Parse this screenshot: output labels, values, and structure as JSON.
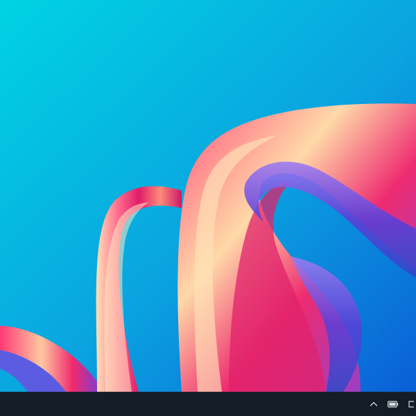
{
  "colors": {
    "wallpaper_top": "#00d0e2",
    "wallpaper_bottom": "#0a63d6",
    "ribbon_pink": "#f0246e",
    "ribbon_cream": "#ffe9c2",
    "ribbon_violet": "#6a3fe0",
    "taskbar_bg": "#141c26",
    "tray_icon": "#d8dde3"
  },
  "taskbar": {
    "tray_icons": [
      "chevron-up-icon",
      "battery-icon",
      "notification-icon"
    ]
  }
}
